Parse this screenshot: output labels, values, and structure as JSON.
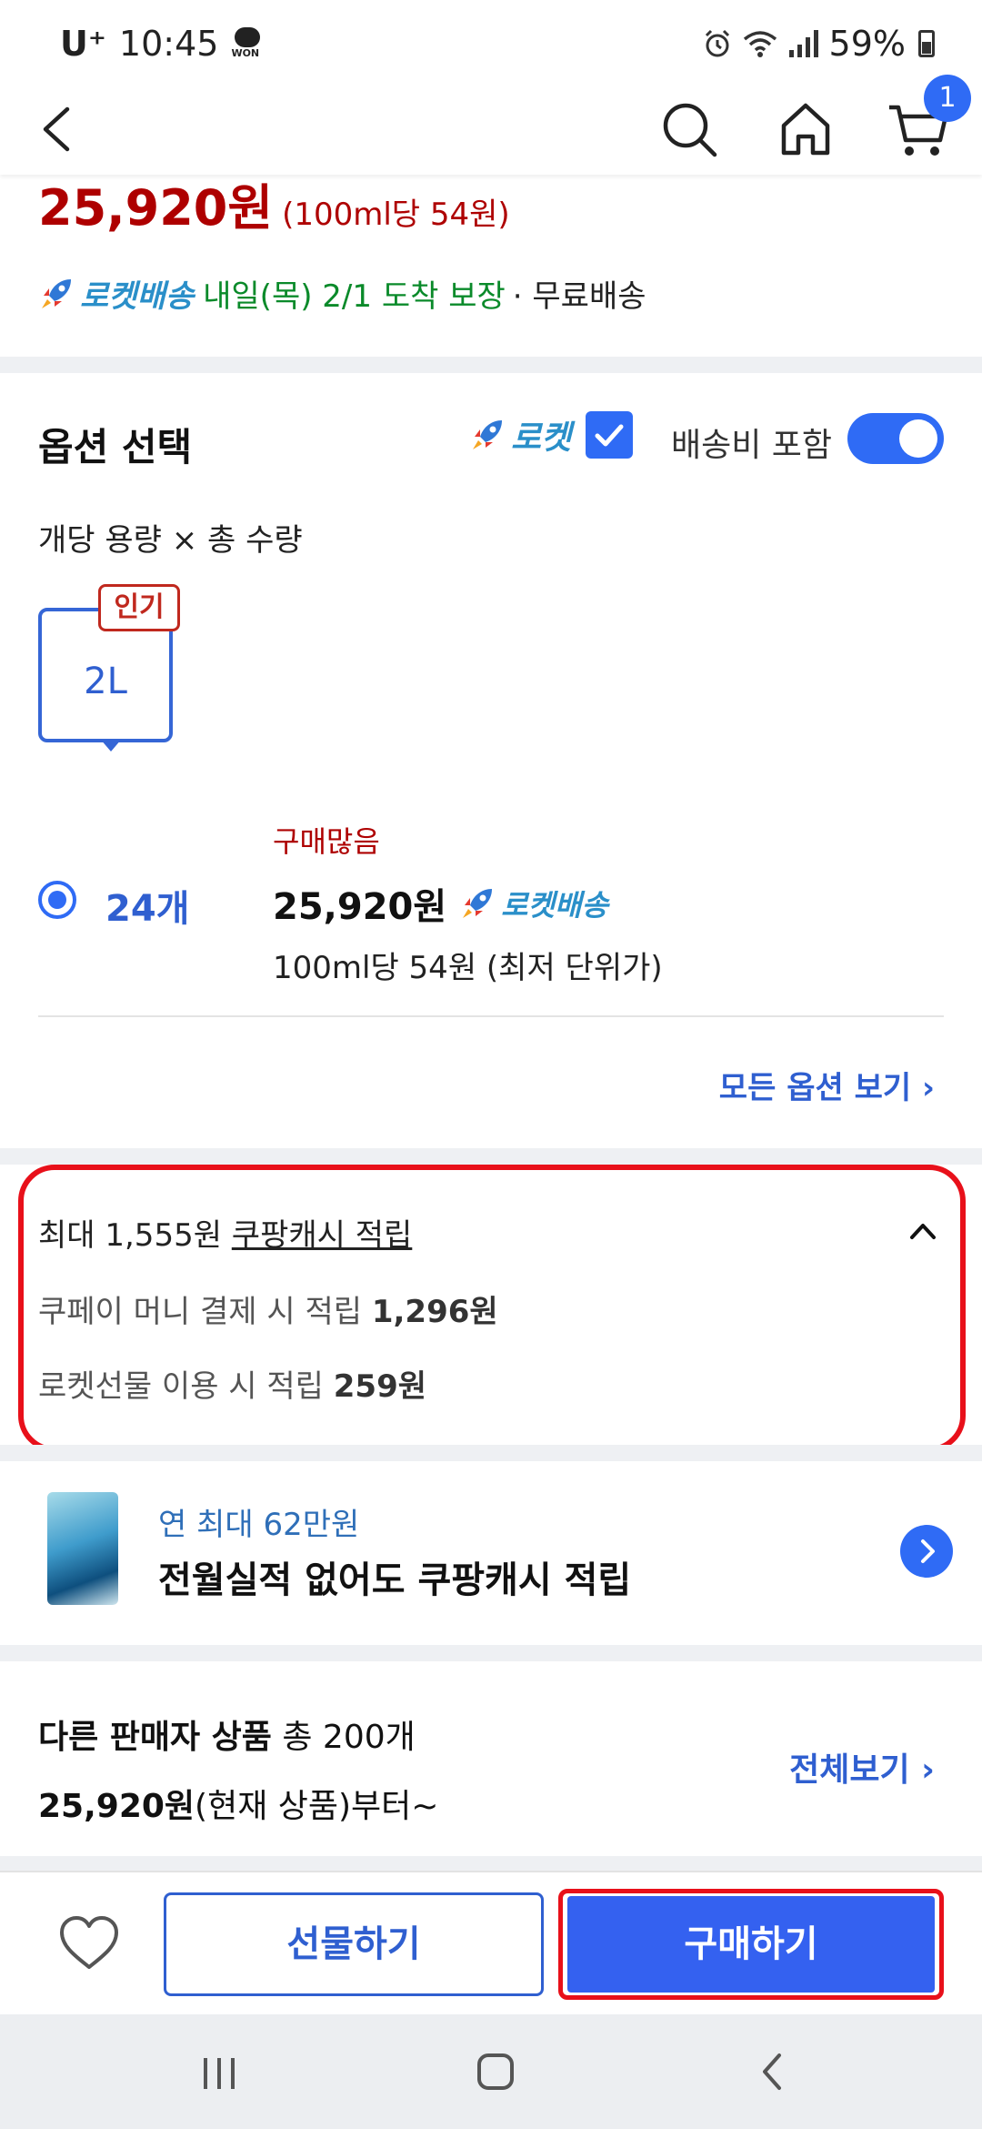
{
  "status_bar": {
    "carrier": "U⁺",
    "time": "10:45",
    "won_label": "WON",
    "battery": "59%"
  },
  "top_nav": {
    "cart_count": "1",
    "icons": [
      "back-icon",
      "search-icon",
      "home-icon",
      "cart-icon"
    ]
  },
  "product": {
    "price": "25,920원",
    "unit_price": "(100ml당 54원)",
    "rocket_label": "로켓배송",
    "delivery_date": "내일(목) 2/1 도착 보장",
    "free_shipping": "· 무료배송"
  },
  "options": {
    "title": "옵션 선택",
    "rocket_filter_label": "로켓",
    "rocket_filter_checked": true,
    "shipping_toggle_label": "배송비 포함",
    "shipping_toggle_on": true,
    "subtitle": "개당 용량 × 총 수량",
    "size": "2L",
    "popular_tag": "인기",
    "quantity": "24개",
    "badge": "구매많음",
    "option_price": "25,920원",
    "option_rocket": "로켓배송",
    "option_unit_price": "100ml당 54원 (최저 단위가)",
    "view_all": "모든 옵션 보기 ›"
  },
  "cash": {
    "line1_prefix": "최대 1,555원 ",
    "line1_link": "쿠팡캐시 적립",
    "line2_text": "쿠페이 머니 결제 시 적립 ",
    "line2_amount": "1,296원",
    "line3_text": "로켓선물 이용 시 적립 ",
    "line3_amount": "259원"
  },
  "card_promo": {
    "sub": "연 최대 62만원",
    "main": "전월실적 없어도 쿠팡캐시 적립"
  },
  "other_sellers": {
    "title_bold": "다른 판매자 상품",
    "title_rest": " 총 200개",
    "price_bold": "25,920원",
    "price_rest": "(현재 상품)부터~",
    "view_all": "전체보기 ›"
  },
  "bottom_bar": {
    "gift_label": "선물하기",
    "buy_label": "구매하기"
  },
  "colors": {
    "price_red": "#ae0000",
    "accent_blue": "#2f6bf5",
    "rocket_blue": "#2a8fc9",
    "delivery_green": "#0a8a2a",
    "highlight_red": "#e8101a"
  }
}
